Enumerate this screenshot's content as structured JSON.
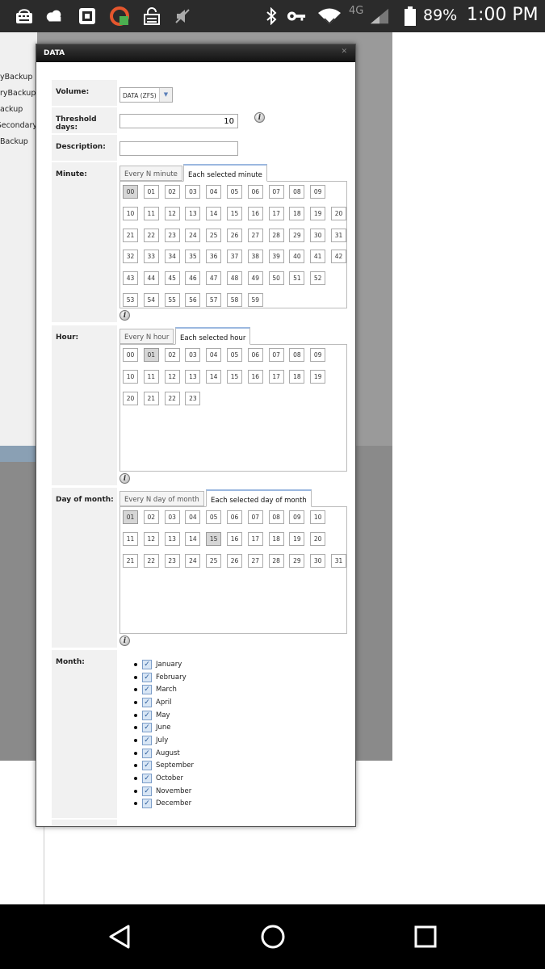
{
  "status_bar": {
    "network": "4G",
    "battery_percent": "89%",
    "time": "1:00 PM"
  },
  "background": {
    "sidebar_items": [
      "yBackup",
      "ryBackup",
      "ackup",
      "Secondary",
      "Backup"
    ]
  },
  "dialog": {
    "title": "DATA",
    "volume": {
      "label": "Volume:",
      "value": "DATA (ZFS)"
    },
    "threshold_days": {
      "label": "Threshold days:",
      "value": "10"
    },
    "description": {
      "label": "Description:",
      "value": ""
    },
    "info_glyph": "i",
    "minute": {
      "label": "Minute:",
      "tabs": [
        "Every N minute",
        "Each selected minute"
      ],
      "active_tab": 1,
      "values": [
        "00",
        "01",
        "02",
        "03",
        "04",
        "05",
        "06",
        "07",
        "08",
        "09",
        "10",
        "11",
        "12",
        "13",
        "14",
        "15",
        "16",
        "17",
        "18",
        "19",
        "20",
        "21",
        "22",
        "23",
        "24",
        "25",
        "26",
        "27",
        "28",
        "29",
        "30",
        "31",
        "32",
        "33",
        "34",
        "35",
        "36",
        "37",
        "38",
        "39",
        "40",
        "41",
        "42",
        "43",
        "44",
        "45",
        "46",
        "47",
        "48",
        "49",
        "50",
        "51",
        "52",
        "53",
        "54",
        "55",
        "56",
        "57",
        "58",
        "59"
      ],
      "selected": [
        "00"
      ]
    },
    "hour": {
      "label": "Hour:",
      "tabs": [
        "Every N hour",
        "Each selected hour"
      ],
      "active_tab": 1,
      "values": [
        "00",
        "01",
        "02",
        "03",
        "04",
        "05",
        "06",
        "07",
        "08",
        "09",
        "10",
        "11",
        "12",
        "13",
        "14",
        "15",
        "16",
        "17",
        "18",
        "19",
        "20",
        "21",
        "22",
        "23"
      ],
      "selected": [
        "01"
      ]
    },
    "day_of_month": {
      "label": "Day of month:",
      "tabs": [
        "Every N day of month",
        "Each selected day of month"
      ],
      "active_tab": 1,
      "values": [
        "01",
        "02",
        "03",
        "04",
        "05",
        "06",
        "07",
        "08",
        "09",
        "10",
        "11",
        "12",
        "13",
        "14",
        "15",
        "16",
        "17",
        "18",
        "19",
        "20",
        "21",
        "22",
        "23",
        "24",
        "25",
        "26",
        "27",
        "28",
        "29",
        "30",
        "31"
      ],
      "selected": [
        "01",
        "15"
      ]
    },
    "month": {
      "label": "Month:",
      "items": [
        {
          "name": "January",
          "checked": true
        },
        {
          "name": "February",
          "checked": true
        },
        {
          "name": "March",
          "checked": true
        },
        {
          "name": "April",
          "checked": true
        },
        {
          "name": "May",
          "checked": true
        },
        {
          "name": "June",
          "checked": true
        },
        {
          "name": "July",
          "checked": true
        },
        {
          "name": "August",
          "checked": true
        },
        {
          "name": "September",
          "checked": true
        },
        {
          "name": "October",
          "checked": true
        },
        {
          "name": "November",
          "checked": true
        },
        {
          "name": "December",
          "checked": true
        }
      ]
    }
  }
}
